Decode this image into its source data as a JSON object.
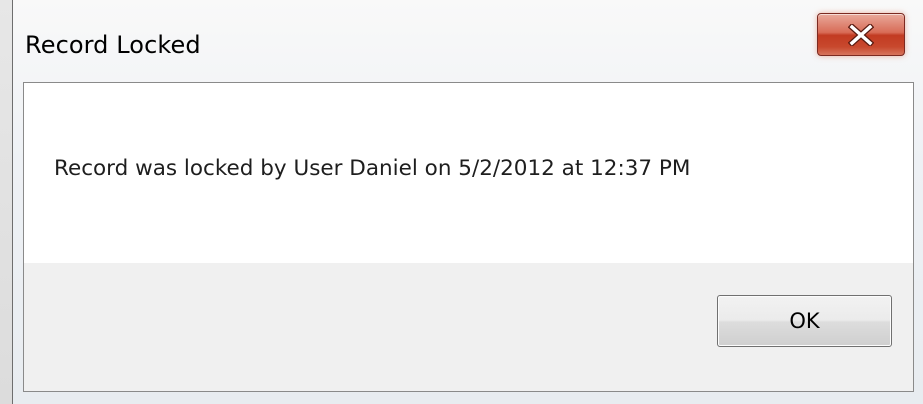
{
  "dialog": {
    "title": "Record Locked",
    "message": "Record was locked by User Daniel on 5/2/2012 at 12:37 PM",
    "ok_label": "OK",
    "close_icon": "close-icon"
  },
  "colors": {
    "close_button": "#c8482d",
    "button_area_bg": "#f0f0f0",
    "message_bg": "#ffffff"
  }
}
